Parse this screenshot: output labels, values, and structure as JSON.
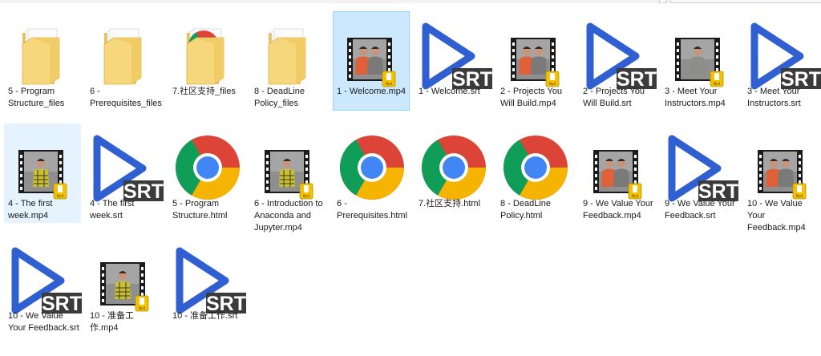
{
  "files": [
    {
      "name": "5 - Program Structure_files",
      "type": "folder"
    },
    {
      "name": "6 - Prerequisites_files",
      "type": "folder-doc"
    },
    {
      "name": "7.社区支持_files",
      "type": "folder-chrome"
    },
    {
      "name": "8 - DeadLine Policy_files",
      "type": "folder"
    },
    {
      "name": "1 - Welcome.mp4",
      "type": "video-two",
      "selected": true
    },
    {
      "name": "1 - Welcome.srt",
      "type": "srt"
    },
    {
      "name": "2 - Projects You Will Build.mp4",
      "type": "video-two"
    },
    {
      "name": "2 - Projects You Will Build.srt",
      "type": "srt"
    },
    {
      "name": "3 - Meet Your Instructors.mp4",
      "type": "video-one"
    },
    {
      "name": "3 - Meet Your Instructors.srt",
      "type": "srt"
    },
    {
      "name": "4 - The first week.mp4",
      "type": "video-plaid",
      "hovered": true
    },
    {
      "name": "4 - The first week.srt",
      "type": "srt"
    },
    {
      "name": "5 - Program Structure.html",
      "type": "chrome"
    },
    {
      "name": "6 - Introduction to Anaconda and Jupyter.mp4",
      "type": "video-plaid"
    },
    {
      "name": "6 - Prerequisites.html",
      "type": "chrome"
    },
    {
      "name": "7.社区支持.html",
      "type": "chrome"
    },
    {
      "name": "8 - DeadLine Policy.html",
      "type": "chrome"
    },
    {
      "name": "9 - We Value Your Feedback.mp4",
      "type": "video-two"
    },
    {
      "name": "9 - We Value Your Feedback.srt",
      "type": "srt"
    },
    {
      "name": "10 - We Value Your Feedback.mp4",
      "type": "video-two"
    },
    {
      "name": "10 - We Value Your Feedback.srt",
      "type": "srt"
    },
    {
      "name": "10 - 准备工作.mp4",
      "type": "video-plaid"
    },
    {
      "name": "10 - 准备工作.srt",
      "type": "srt"
    }
  ],
  "srt_badge": "SRT",
  "colors": {
    "selected_bg": "#cce8ff",
    "selected_border": "#99d1ff",
    "hover_bg": "#e5f3ff",
    "folder": "#f6d77b",
    "srt_play": "#2f5fd1",
    "badge_bg": "#3b3b3b",
    "chrome_red": "#db4437",
    "chrome_green": "#0f9d58",
    "chrome_yellow": "#f4b400",
    "chrome_blue": "#4285f4"
  }
}
